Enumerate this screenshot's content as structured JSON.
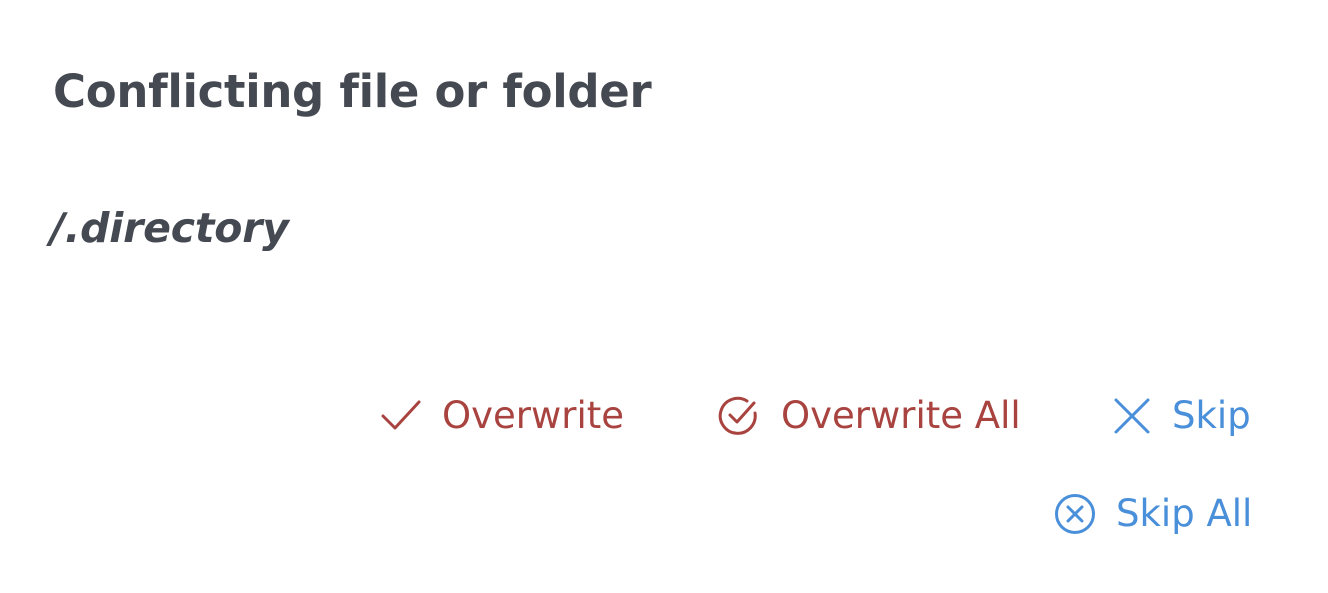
{
  "dialog": {
    "title": "Conflicting file or folder",
    "path": "/.directory"
  },
  "actions": {
    "overwrite": {
      "label": "Overwrite",
      "icon": "check-icon",
      "color": "#a8433f"
    },
    "overwrite_all": {
      "label": "Overwrite All",
      "icon": "check-circle-icon",
      "color": "#a8433f"
    },
    "skip": {
      "label": "Skip",
      "icon": "close-icon",
      "color": "#4a8fd9"
    },
    "skip_all": {
      "label": "Skip All",
      "icon": "close-circle-icon",
      "color": "#4a8fd9"
    }
  }
}
